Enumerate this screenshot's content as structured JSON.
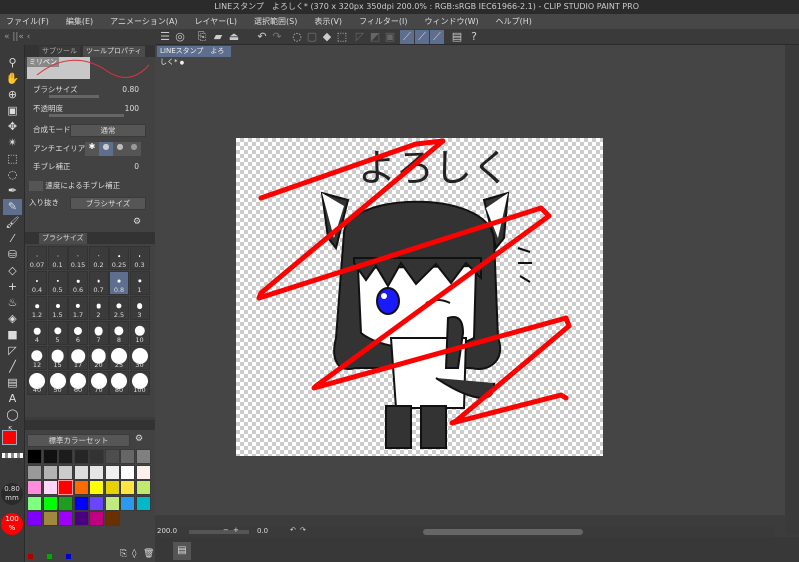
{
  "titlebar": {
    "title": "LINEスタンプ　よろしく* (370 x 320px 350dpi 200.0% : RGB:sRGB IEC61966-2.1)  - CLIP STUDIO PAINT PRO"
  },
  "menu": [
    "ファイル(F)",
    "編集(E)",
    "アニメーション(A)",
    "レイヤー(L)",
    "選択範囲(S)",
    "表示(V)",
    "フィルター(I)",
    "ウィンドウ(W)",
    "ヘルプ(H)"
  ],
  "document_tab": {
    "label": "LINEスタンプ　よろしく*",
    "dot": "●"
  },
  "left_header": {
    "label": "«  ||«  ‹"
  },
  "tool_property": {
    "tabs": [
      "サブツール",
      "ツールプロパティ"
    ],
    "tool_name": "ミリペン",
    "brush_size_label": "ブラシサイズ",
    "brush_size_value": "0.80",
    "opacity_label": "不透明度",
    "opacity_value": "100",
    "blend_label": "合成モード",
    "blend_value": "通常",
    "antialias_label": "アンチエイリアス",
    "stabilization_label": "手ブレ補正",
    "stabilization_value": "0",
    "speed_stab_label": "速度による手ブレ補正",
    "taper_label": "入り抜き",
    "taper_value": "ブラシサイズ"
  },
  "brush_size_panel": {
    "title": "ブラシサイズ",
    "sizes": [
      "0.07",
      "0.1",
      "0.15",
      "0.2",
      "0.25",
      "0.3",
      "0.4",
      "0.5",
      "0.6",
      "0.7",
      "0.8",
      "1",
      "1.2",
      "1.5",
      "1.7",
      "2",
      "2.5",
      "3",
      "4",
      "5",
      "6",
      "7",
      "8",
      "10",
      "12",
      "15",
      "17",
      "20",
      "25",
      "30",
      "40",
      "50",
      "60",
      "70",
      "80",
      "100"
    ],
    "selected": "0.8"
  },
  "color_panel": {
    "set_name": "標準カラーセット",
    "swatches": [
      "#000000",
      "#111111",
      "#1c1c1c",
      "#262626",
      "#333333",
      "#4d4d4d",
      "#666666",
      "#808080",
      "#999999",
      "#b3b3b3",
      "#cccccc",
      "#dddddd",
      "#e6e6e6",
      "#f0f0f0",
      "#ffffff",
      "#fdf0ea",
      "#ff8cdc",
      "#ffd6f5",
      "#ff0000",
      "#ff6a00",
      "#ffff00",
      "#e6d200",
      "#ffe640",
      "#bfea6e",
      "#7fff7f",
      "#00ff00",
      "#1e9e1e",
      "#0000ff",
      "#6a45ff",
      "#c0ea80",
      "#2a99f0",
      "#00b8c8",
      "#8000ff",
      "#a08840",
      "#a000ff",
      "#4a0080",
      "#c00080",
      "#6a3000"
    ],
    "main_color": "#ff0000",
    "sub_color": "#ffffff"
  },
  "side_indicators": {
    "brush_size": "0.80",
    "brush_unit": "mm",
    "opacity": "100",
    "opacity_unit": "%"
  },
  "canvas": {
    "text": "よろしく",
    "stroke_color": "#ff0000",
    "eye_color": "#1a1aff"
  },
  "statusbar": {
    "zoom": "200.0",
    "rotation": "0.0"
  }
}
